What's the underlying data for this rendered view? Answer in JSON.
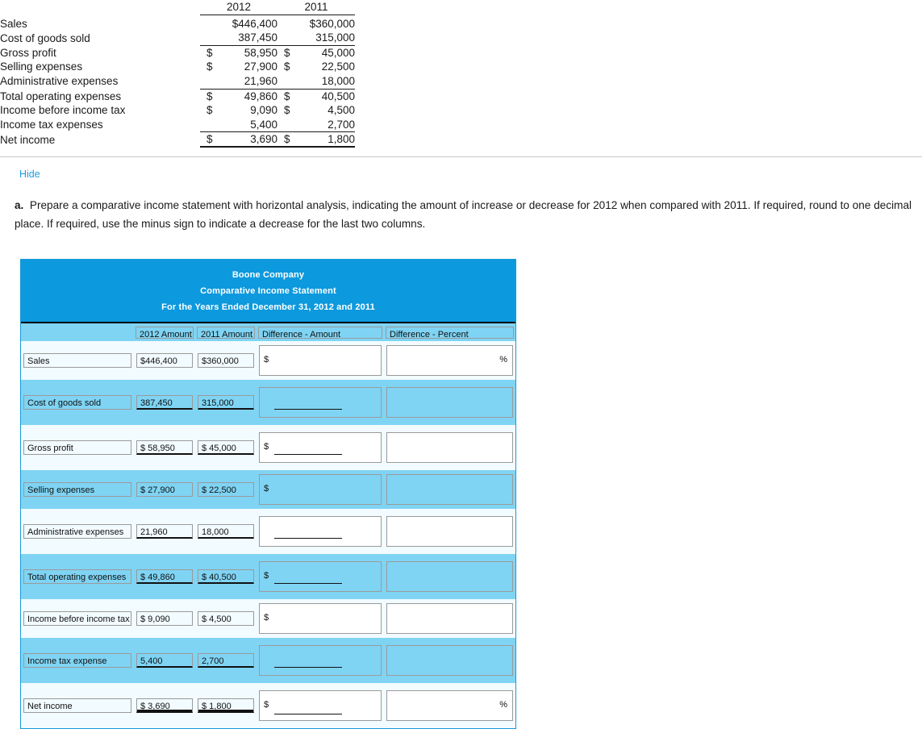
{
  "reference_statement": {
    "columns": [
      "2012",
      "2011"
    ],
    "rows": [
      {
        "label": "Sales",
        "v2012": "$446,400",
        "v2011": "$360,000",
        "rule": "none",
        "dollar": false
      },
      {
        "label": "Cost of goods sold",
        "v2012": "387,450",
        "v2011": "315,000",
        "rule": "single",
        "dollar": false
      },
      {
        "label": "Gross profit",
        "v2012": "58,950",
        "v2011": "45,000",
        "rule": "none",
        "dollar": true
      },
      {
        "label": "Selling expenses",
        "v2012": "27,900",
        "v2011": "22,500",
        "rule": "none",
        "dollar": true
      },
      {
        "label": "Administrative expenses",
        "v2012": "21,960",
        "v2011": "18,000",
        "rule": "single",
        "dollar": false
      },
      {
        "label": "Total operating expenses",
        "v2012": "49,860",
        "v2011": "40,500",
        "rule": "none",
        "dollar": true
      },
      {
        "label": "Income before income tax",
        "v2012": "9,090",
        "v2011": "4,500",
        "rule": "none",
        "dollar": true
      },
      {
        "label": "Income tax expenses",
        "v2012": "5,400",
        "v2011": "2,700",
        "rule": "single",
        "dollar": false
      },
      {
        "label": "Net income",
        "v2012": "3,690",
        "v2011": "1,800",
        "rule": "double",
        "dollar": true
      }
    ]
  },
  "panel": {
    "hide_label": "Hide",
    "step_marker": "a.",
    "instruction": "Prepare a comparative income statement with horizontal analysis, indicating the amount of increase or decrease for 2012 when compared with 2011. If required, round to one decimal place. If required, use the minus sign to indicate a decrease for the last two columns."
  },
  "worksheet": {
    "title_lines": [
      "Boone Company",
      "Comparative Income Statement",
      "For the Years Ended December 31, 2012 and 2011"
    ],
    "headers": {
      "label": "",
      "amount_2012": "2012 Amount",
      "amount_2011": "2011 Amount",
      "difference_amount": "Difference - Amount",
      "difference_percent": "Difference - Percent"
    },
    "rows": [
      {
        "label": "Sales",
        "a2012": "$446,400",
        "a2011": "$360,000",
        "amount_rule": "none",
        "band": "white",
        "diff_amount": {
          "symbol": "$",
          "value": "",
          "rule": "none"
        },
        "diff_percent": {
          "symbol": "%",
          "value": "",
          "rule": "none"
        }
      },
      {
        "label": "Cost of goods sold",
        "a2012": "387,450",
        "a2011": "315,000",
        "amount_rule": "single",
        "band": "blue",
        "diff_amount": {
          "symbol": "",
          "value": "",
          "rule": "single"
        },
        "diff_percent": {
          "symbol": "",
          "value": "",
          "rule": "none"
        }
      },
      {
        "label": "Gross profit",
        "a2012": "$ 58,950",
        "a2011": "$ 45,000",
        "amount_rule": "single",
        "band": "white",
        "diff_amount": {
          "symbol": "$",
          "value": "",
          "rule": "single"
        },
        "diff_percent": {
          "symbol": "",
          "value": "",
          "rule": "none"
        }
      },
      {
        "label": "Selling expenses",
        "a2012": "$ 27,900",
        "a2011": "$ 22,500",
        "amount_rule": "none",
        "band": "blue",
        "diff_amount": {
          "symbol": "$",
          "value": "",
          "rule": "none"
        },
        "diff_percent": {
          "symbol": "",
          "value": "",
          "rule": "none"
        }
      },
      {
        "label": "Administrative expenses",
        "a2012": "21,960",
        "a2011": "18,000",
        "amount_rule": "single",
        "band": "white",
        "diff_amount": {
          "symbol": "",
          "value": "",
          "rule": "single"
        },
        "diff_percent": {
          "symbol": "",
          "value": "",
          "rule": "none"
        }
      },
      {
        "label": "Total operating expenses",
        "a2012": "$ 49,860",
        "a2011": "$ 40,500",
        "amount_rule": "single",
        "band": "blue",
        "diff_amount": {
          "symbol": "$",
          "value": "",
          "rule": "single"
        },
        "diff_percent": {
          "symbol": "",
          "value": "",
          "rule": "none"
        }
      },
      {
        "label": "Income before income tax",
        "a2012": "$ 9,090",
        "a2011": "$ 4,500",
        "amount_rule": "none",
        "band": "white",
        "diff_amount": {
          "symbol": "$",
          "value": "",
          "rule": "none"
        },
        "diff_percent": {
          "symbol": "",
          "value": "",
          "rule": "none"
        }
      },
      {
        "label": "Income tax expense",
        "a2012": "5,400",
        "a2011": "2,700",
        "amount_rule": "single",
        "band": "blue",
        "diff_amount": {
          "symbol": "",
          "value": "",
          "rule": "single"
        },
        "diff_percent": {
          "symbol": "",
          "value": "",
          "rule": "none"
        }
      },
      {
        "label": "Net income",
        "a2012": "$ 3,690",
        "a2011": "$ 1,800",
        "amount_rule": "double",
        "band": "white",
        "diff_amount": {
          "symbol": "$",
          "value": "",
          "rule": "double"
        },
        "diff_percent": {
          "symbol": "%",
          "value": "",
          "rule": "none"
        }
      }
    ]
  },
  "colors": {
    "header_blue": "#0d99dd",
    "band_blue": "#7fd4f4",
    "band_white": "#f2fbff",
    "link_blue": "#1a9de0",
    "border_blue": "#1a9ad9",
    "box_border": "#9a9a9a"
  }
}
